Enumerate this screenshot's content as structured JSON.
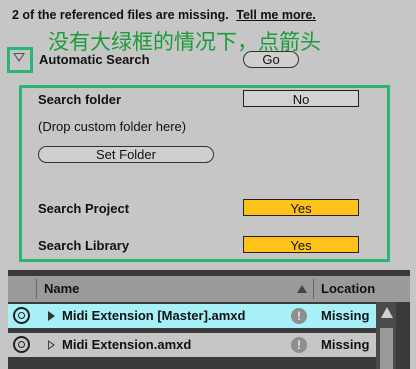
{
  "header": {
    "message": "2 of the referenced files are missing.",
    "link_label": "Tell me more."
  },
  "annotation": {
    "text": "没有大绿框的情况下，点箭头"
  },
  "automatic_search": {
    "label": "Automatic Search",
    "go_label": "Go"
  },
  "search_panel": {
    "search_folder_label": "Search folder",
    "search_folder_value": "No",
    "drop_hint": "(Drop custom folder here)",
    "set_folder_label": "Set Folder",
    "search_project_label": "Search Project",
    "search_project_value": "Yes",
    "search_library_label": "Search Library",
    "search_library_value": "Yes"
  },
  "table": {
    "columns": [
      "Name",
      "Location"
    ],
    "rows": [
      {
        "name": "Midi Extension [Master].amxd",
        "location": "Missing",
        "selected": true
      },
      {
        "name": "Midi Extension.amxd",
        "location": "Missing",
        "selected": false
      }
    ]
  },
  "colors": {
    "background": "#c6c6c6",
    "toggle_on": "#ffc21a",
    "highlight_box": "#2bb673",
    "selected_row": "#a8f0f8",
    "annotation_text": "#1a9c3a"
  }
}
